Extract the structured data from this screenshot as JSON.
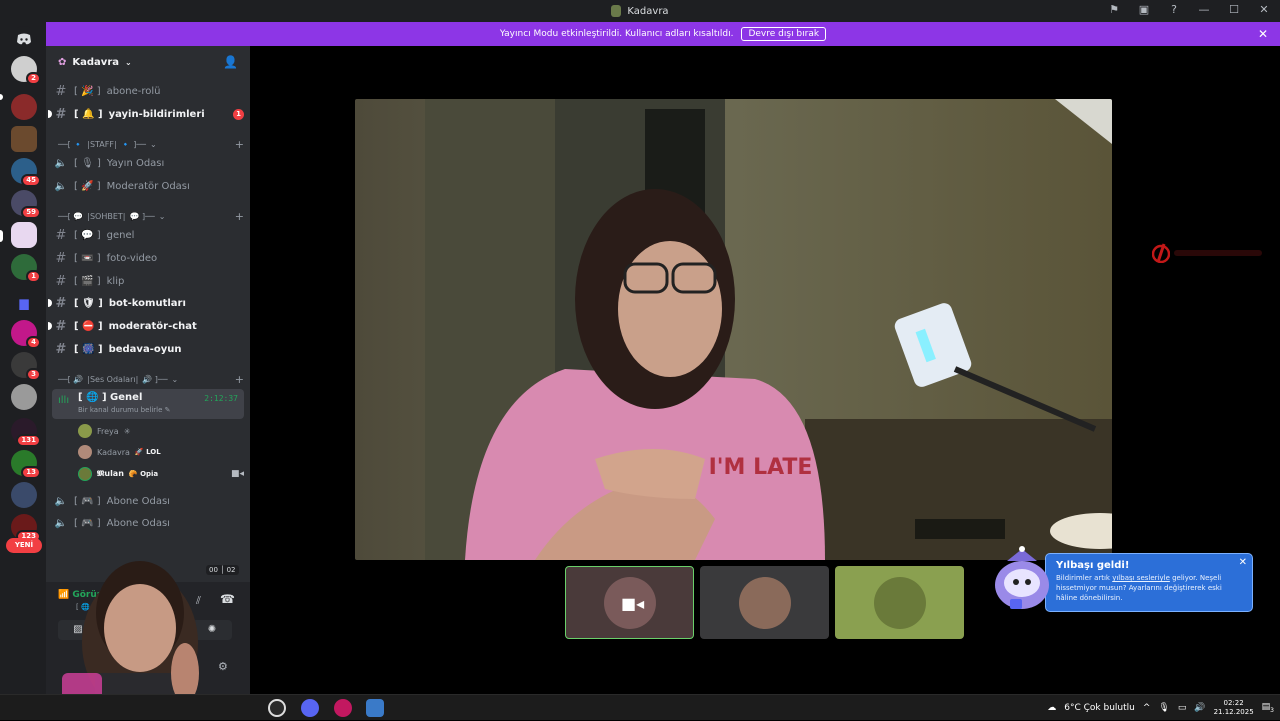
{
  "window": {
    "title": "Kadavra"
  },
  "banner": {
    "text": "Yayıncı Modu etkinleştirildi. Kullanıcı adları kısaltıldı.",
    "button": "Devre dışı bırak"
  },
  "server_badges": [
    "2",
    "45",
    "59",
    "1",
    "4",
    "3",
    "131",
    "13",
    "123"
  ],
  "server_new": "YENİ",
  "guild": {
    "name": "Kadavra"
  },
  "channels": [
    {
      "name": "abone-rolü",
      "emoji": "🎉",
      "unread": false
    },
    {
      "name": "yayin-bildirimleri",
      "emoji": "🔔",
      "unread": true,
      "badge": "1"
    }
  ],
  "categories": {
    "staff": "|STAFF|",
    "sohbet": "|SOHBET|",
    "ses": "|Ses Odaları|"
  },
  "staff_channels": [
    {
      "name": "Yayın Odası",
      "emoji": "🎙"
    },
    {
      "name": "Moderatör Odası",
      "emoji": "🚀"
    }
  ],
  "sohbet_channels": [
    {
      "name": "genel",
      "emoji": "💬",
      "unread": false
    },
    {
      "name": "foto-video",
      "emoji": "📼",
      "unread": false
    },
    {
      "name": "klip",
      "emoji": "🎬",
      "unread": false
    },
    {
      "name": "bot-komutları",
      "emoji": "🛡",
      "unread": true
    },
    {
      "name": "moderatör-chat",
      "emoji": "⛔",
      "unread": true
    },
    {
      "name": "bedava-oyun",
      "emoji": "🎆",
      "unread": true
    }
  ],
  "active_voice": {
    "name": "Genel",
    "status": "Bir kanal durumu belirle",
    "timer": "2:12:37"
  },
  "voice_members": [
    {
      "name": "Freya",
      "tag": ""
    },
    {
      "name": "Kadavra",
      "tag": "LOL"
    },
    {
      "name": "𝕸ulan",
      "tag": "Opia"
    }
  ],
  "other_voice": [
    {
      "name": "Abone Odası"
    },
    {
      "name": "Abone Odası"
    }
  ],
  "voice_count": {
    "left": "00",
    "right": "02"
  },
  "connection": {
    "label": "Görünt",
    "sub": "[ 🌐 ] G"
  },
  "tip": {
    "title": "Yılbaşı geldi!",
    "body_pre": "Bildirimler artık ",
    "body_link": "yılbaşı sesleriyle",
    "body_post": " geliyor. Neşeli hissetmiyor musun? Ayarlarını değiştirerek eski hâline dönebilirsin."
  },
  "taskbar": {
    "weather": "6°C  Çok bulutlu",
    "time": "02:22",
    "date": "21.12.2025",
    "notif": "3"
  },
  "colors": {
    "accent": "#8d36e6",
    "tip": "#2c6fd8",
    "online": "#23a55a",
    "badge": "#f23f43"
  }
}
